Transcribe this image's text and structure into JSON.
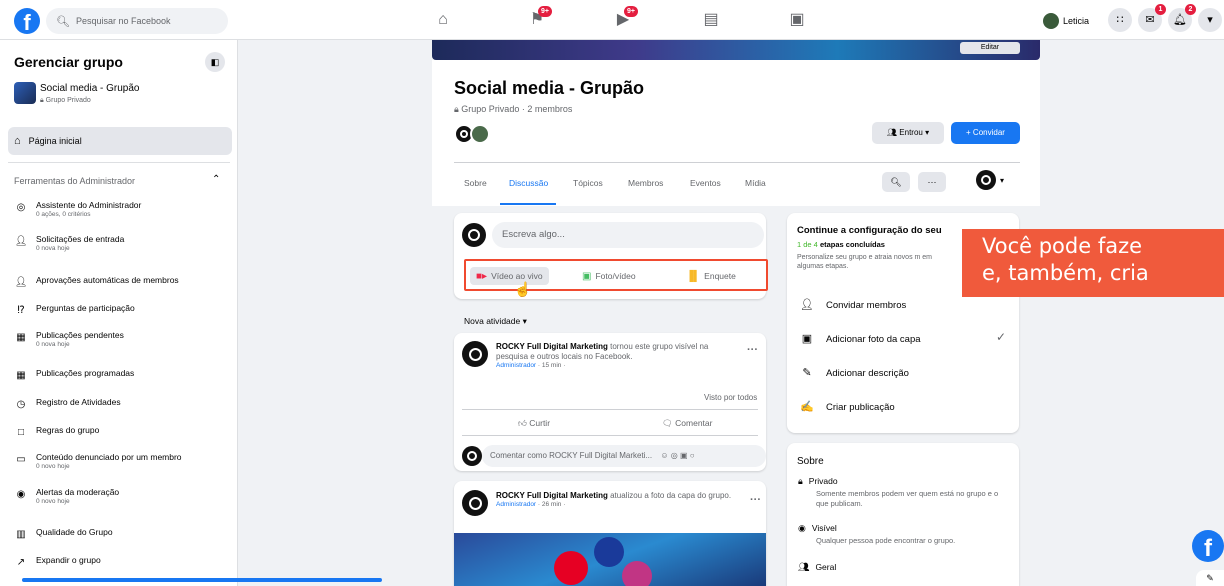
{
  "topbar": {
    "logo": "f",
    "search_placeholder": "Pesquisar no Facebook",
    "nav_badges": {
      "groups": "9+",
      "watch": "9+"
    },
    "user_name": "Leticia",
    "messenger_badge": "1",
    "notif_badge": "2"
  },
  "sidebar": {
    "title": "Gerenciar grupo",
    "group_name": "Social media - Grupão",
    "group_privacy": "Grupo Privado",
    "home": "Página inicial",
    "admin_tools_header": "Ferramentas do Administrador",
    "items": [
      {
        "label": "Assistente do Administrador",
        "sub": "0 ações, 0 critérios"
      },
      {
        "label": "Solicitações de entrada",
        "sub": "0 nova hoje"
      },
      {
        "label": "Aprovações automáticas de membros",
        "sub": ""
      },
      {
        "label": "Perguntas de participação",
        "sub": ""
      },
      {
        "label": "Publicações pendentes",
        "sub": "0 nova hoje"
      },
      {
        "label": "Publicações programadas",
        "sub": ""
      },
      {
        "label": "Registro de Atividades",
        "sub": ""
      },
      {
        "label": "Regras do grupo",
        "sub": ""
      },
      {
        "label": "Conteúdo denunciado por um membro",
        "sub": "0 novo hoje"
      },
      {
        "label": "Alertas da moderação",
        "sub": "0 novo hoje"
      },
      {
        "label": "Qualidade do Grupo",
        "sub": ""
      },
      {
        "label": "Expandir o grupo",
        "sub": ""
      }
    ]
  },
  "group": {
    "cover_button": "Editar",
    "title": "Social media - Grupão",
    "subtitle": "Grupo Privado · 2 membros",
    "joined_button": "Entrou",
    "invite_button": "+ Convidar",
    "tabs": [
      "Sobre",
      "Discussão",
      "Tópicos",
      "Membros",
      "Eventos",
      "Mídia"
    ],
    "more_button": "···"
  },
  "composer": {
    "placeholder": "Escreva algo...",
    "live_video": "Vídeo ao vivo",
    "photo_video": "Foto/vídeo",
    "poll": "Enquete"
  },
  "feed": {
    "activity_label": "Nova atividade",
    "post1": {
      "author": "ROCKY Full Digital Marketing",
      "text": " tornou este grupo visível na pesquisa e outros locais no Facebook.",
      "role": "Administrador",
      "time": "· 15 min ·",
      "seen_by": "Visto por todos",
      "like": "Curtir",
      "comment": "Comentar",
      "comment_placeholder": "Comentar como ROCKY Full Digital Marketi..."
    },
    "post2": {
      "author": "ROCKY Full Digital Marketing",
      "text": " atualizou a foto da capa do grupo.",
      "role": "Administrador",
      "time": "· 26 min ·"
    }
  },
  "setup": {
    "title": "Continue a configuração do seu",
    "progress_count": "1 de 4",
    "progress_text": " etapas concluídas",
    "description": "Personalize seu grupo e atraia novos m em algumas etapas.",
    "items": [
      "Convidar membros",
      "Adicionar foto da capa",
      "Adicionar descrição",
      "Criar publicação"
    ]
  },
  "about": {
    "title": "Sobre",
    "private_label": "Privado",
    "private_desc": "Somente membros podem ver quem está no grupo e o que publicam.",
    "visible_label": "Visível",
    "visible_desc": "Qualquer pessoa pode encontrar o grupo.",
    "general_label": "Geral"
  },
  "caption": {
    "line1": "Você pode faze",
    "line2": "e, também, cria"
  },
  "colors": {
    "brand": "#1877f2",
    "highlight": "#f04a2f",
    "caption_bg": "#f05a3c"
  }
}
